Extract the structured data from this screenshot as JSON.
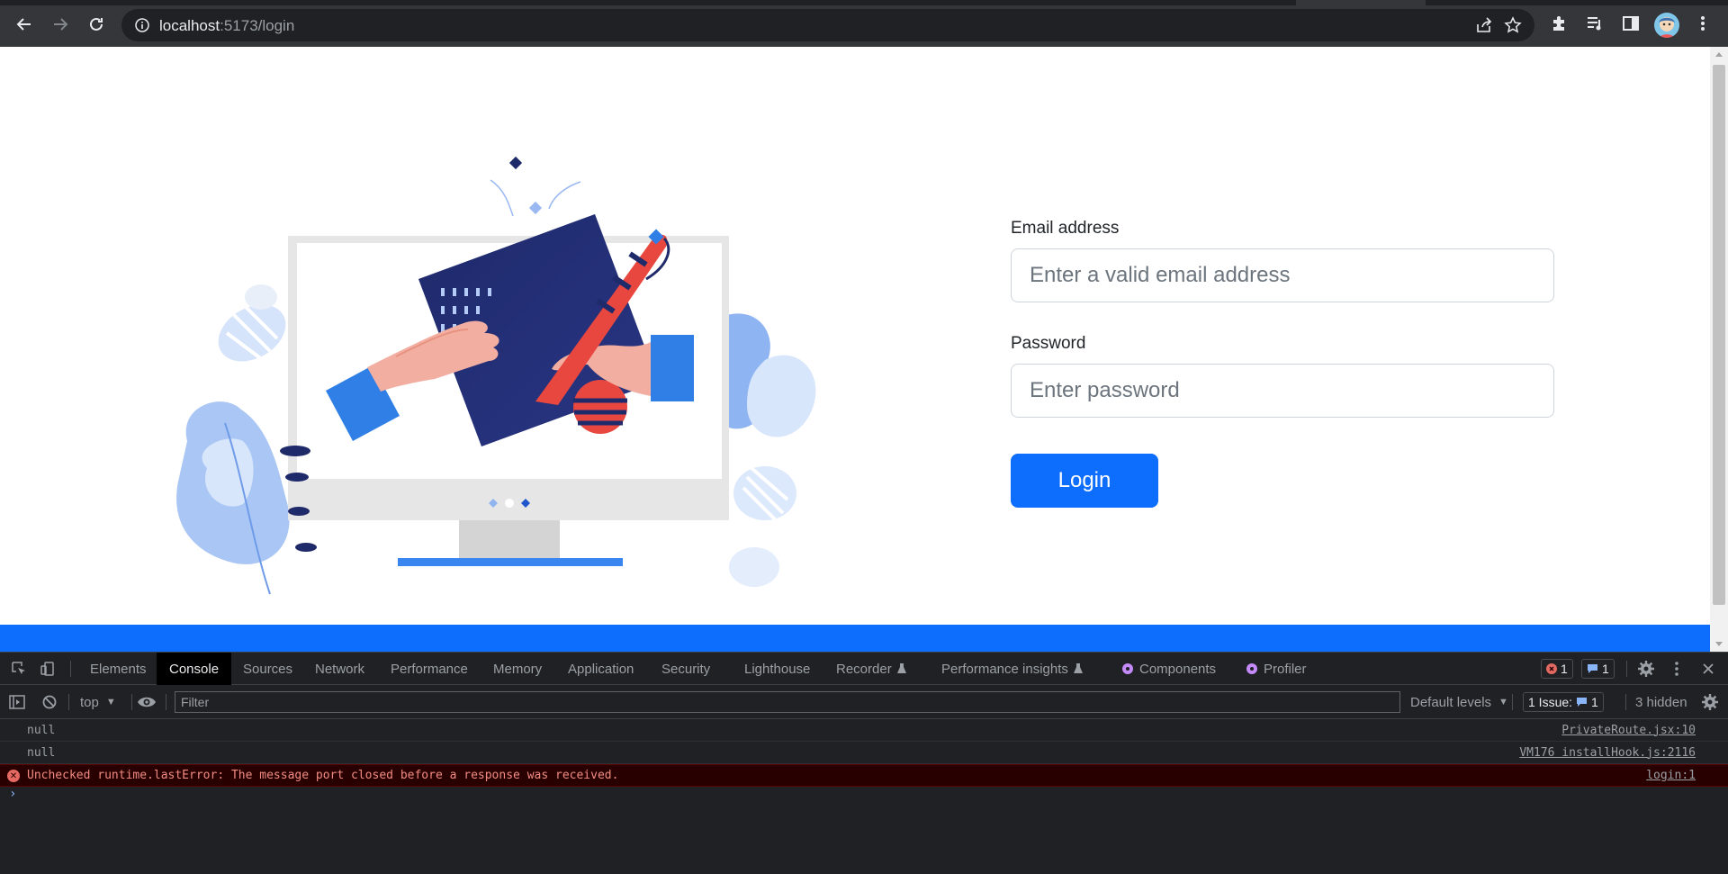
{
  "browser": {
    "url_host": "localhost",
    "url_rest": ":5173/login"
  },
  "page": {
    "email_label": "Email address",
    "email_placeholder": "Enter a valid email address",
    "password_label": "Password",
    "password_placeholder": "Enter password",
    "login_label": "Login",
    "colors": {
      "primary": "#0d6efd",
      "navy": "#1f2a6b",
      "accent_red": "#e8473f"
    }
  },
  "devtools": {
    "tabs": [
      "Elements",
      "Console",
      "Sources",
      "Network",
      "Performance",
      "Memory",
      "Application",
      "Security",
      "Lighthouse",
      "Recorder",
      "Performance insights",
      "Components",
      "Profiler"
    ],
    "active_tab": "Console",
    "error_count": "1",
    "message_count": "1",
    "context": "top",
    "filter_placeholder": "Filter",
    "levels": "Default levels",
    "issues_label": "1 Issue:",
    "issues_count": "1",
    "hidden": "3 hidden",
    "messages": [
      {
        "text": "null",
        "source": "PrivateRoute.jsx:10",
        "level": "log"
      },
      {
        "text": "null",
        "source": "VM176 installHook.js:2116",
        "level": "log"
      },
      {
        "text": "Unchecked runtime.lastError: The message port closed before a response was received.",
        "source": "login:1",
        "level": "error"
      }
    ],
    "prompt": "›"
  }
}
